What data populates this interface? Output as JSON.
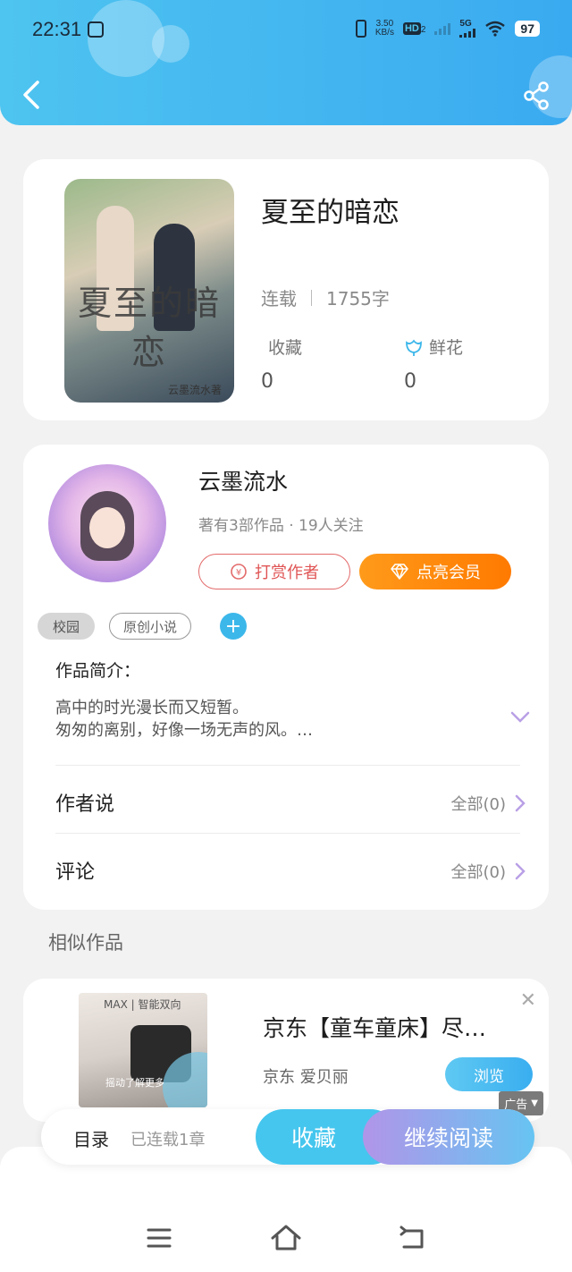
{
  "status_bar": {
    "time": "22:31",
    "net_speed_top": "3.50",
    "net_speed_unit": "KB/s",
    "hd_label": "HD",
    "hd_sub": "2",
    "signal_label": "5G",
    "battery": "97"
  },
  "book": {
    "cover_title": "夏至的暗恋",
    "cover_author": "云墨流水著",
    "title": "夏至的暗恋",
    "status": "连载",
    "word_count": "1755字",
    "collect_label": "收藏",
    "collect_value": "0",
    "flower_label": "鲜花",
    "flower_value": "0"
  },
  "author": {
    "name": "云墨流水",
    "meta": "著有3部作品 · 19人关注",
    "tip_button": "打赏作者",
    "vip_button": "点亮会员",
    "tags": [
      "校园",
      "原创小说"
    ],
    "add_tag": "+"
  },
  "intro": {
    "label": "作品简介：",
    "line1": "高中的时光漫长而又短暂。",
    "line2": "匆匆的离别，好像一场无声的风。…"
  },
  "rows": {
    "author_says_label": "作者说",
    "author_says_value": "全部(0)",
    "comments_label": "评论",
    "comments_value": "全部(0)"
  },
  "similar": {
    "title": "相似作品"
  },
  "ad": {
    "image_headline": "MAX | 智能双向",
    "image_caption": "摇动了解更多",
    "title": "京东【童车童床】尽…",
    "brand": "京东 爱贝丽",
    "button": "浏览",
    "badge": "广告"
  },
  "bottom_bar": {
    "toc": "目录",
    "status": "已连载1章",
    "collect": "收藏",
    "read": "继续阅读"
  },
  "colors": {
    "header_gradient_start": "#4ec4f0",
    "header_gradient_end": "#3aaaf0",
    "tip_red": "#e05555",
    "vip_orange": "#ff8a00",
    "accent_blue": "#3cb7ea",
    "accent_purple": "#b195e8"
  }
}
